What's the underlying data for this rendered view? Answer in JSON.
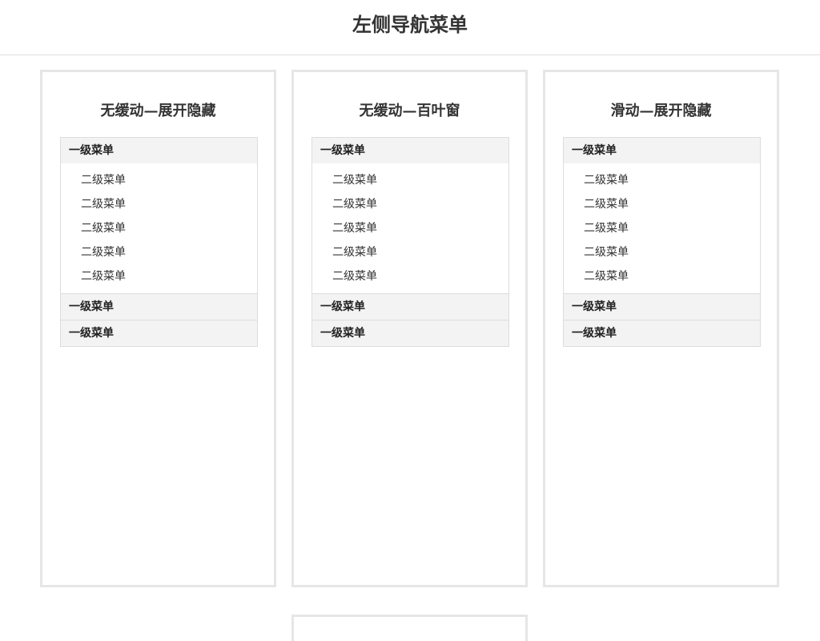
{
  "page": {
    "title": "左侧导航菜单"
  },
  "panels": [
    {
      "title": "无缓动—展开隐藏",
      "groups": [
        {
          "label": "一级菜单",
          "items": [
            "二级菜单",
            "二级菜单",
            "二级菜单",
            "二级菜单",
            "二级菜单"
          ]
        },
        {
          "label": "一级菜单",
          "items": []
        },
        {
          "label": "一级菜单",
          "items": []
        }
      ]
    },
    {
      "title": "无缓动—百叶窗",
      "groups": [
        {
          "label": "一级菜单",
          "items": [
            "二级菜单",
            "二级菜单",
            "二级菜单",
            "二级菜单",
            "二级菜单"
          ]
        },
        {
          "label": "一级菜单",
          "items": []
        },
        {
          "label": "一级菜单",
          "items": []
        }
      ]
    },
    {
      "title": "滑动—展开隐藏",
      "groups": [
        {
          "label": "一级菜单",
          "items": [
            "二级菜单",
            "二级菜单",
            "二级菜单",
            "二级菜单",
            "二级菜单"
          ]
        },
        {
          "label": "一级菜单",
          "items": []
        },
        {
          "label": "一级菜单",
          "items": []
        }
      ]
    }
  ]
}
